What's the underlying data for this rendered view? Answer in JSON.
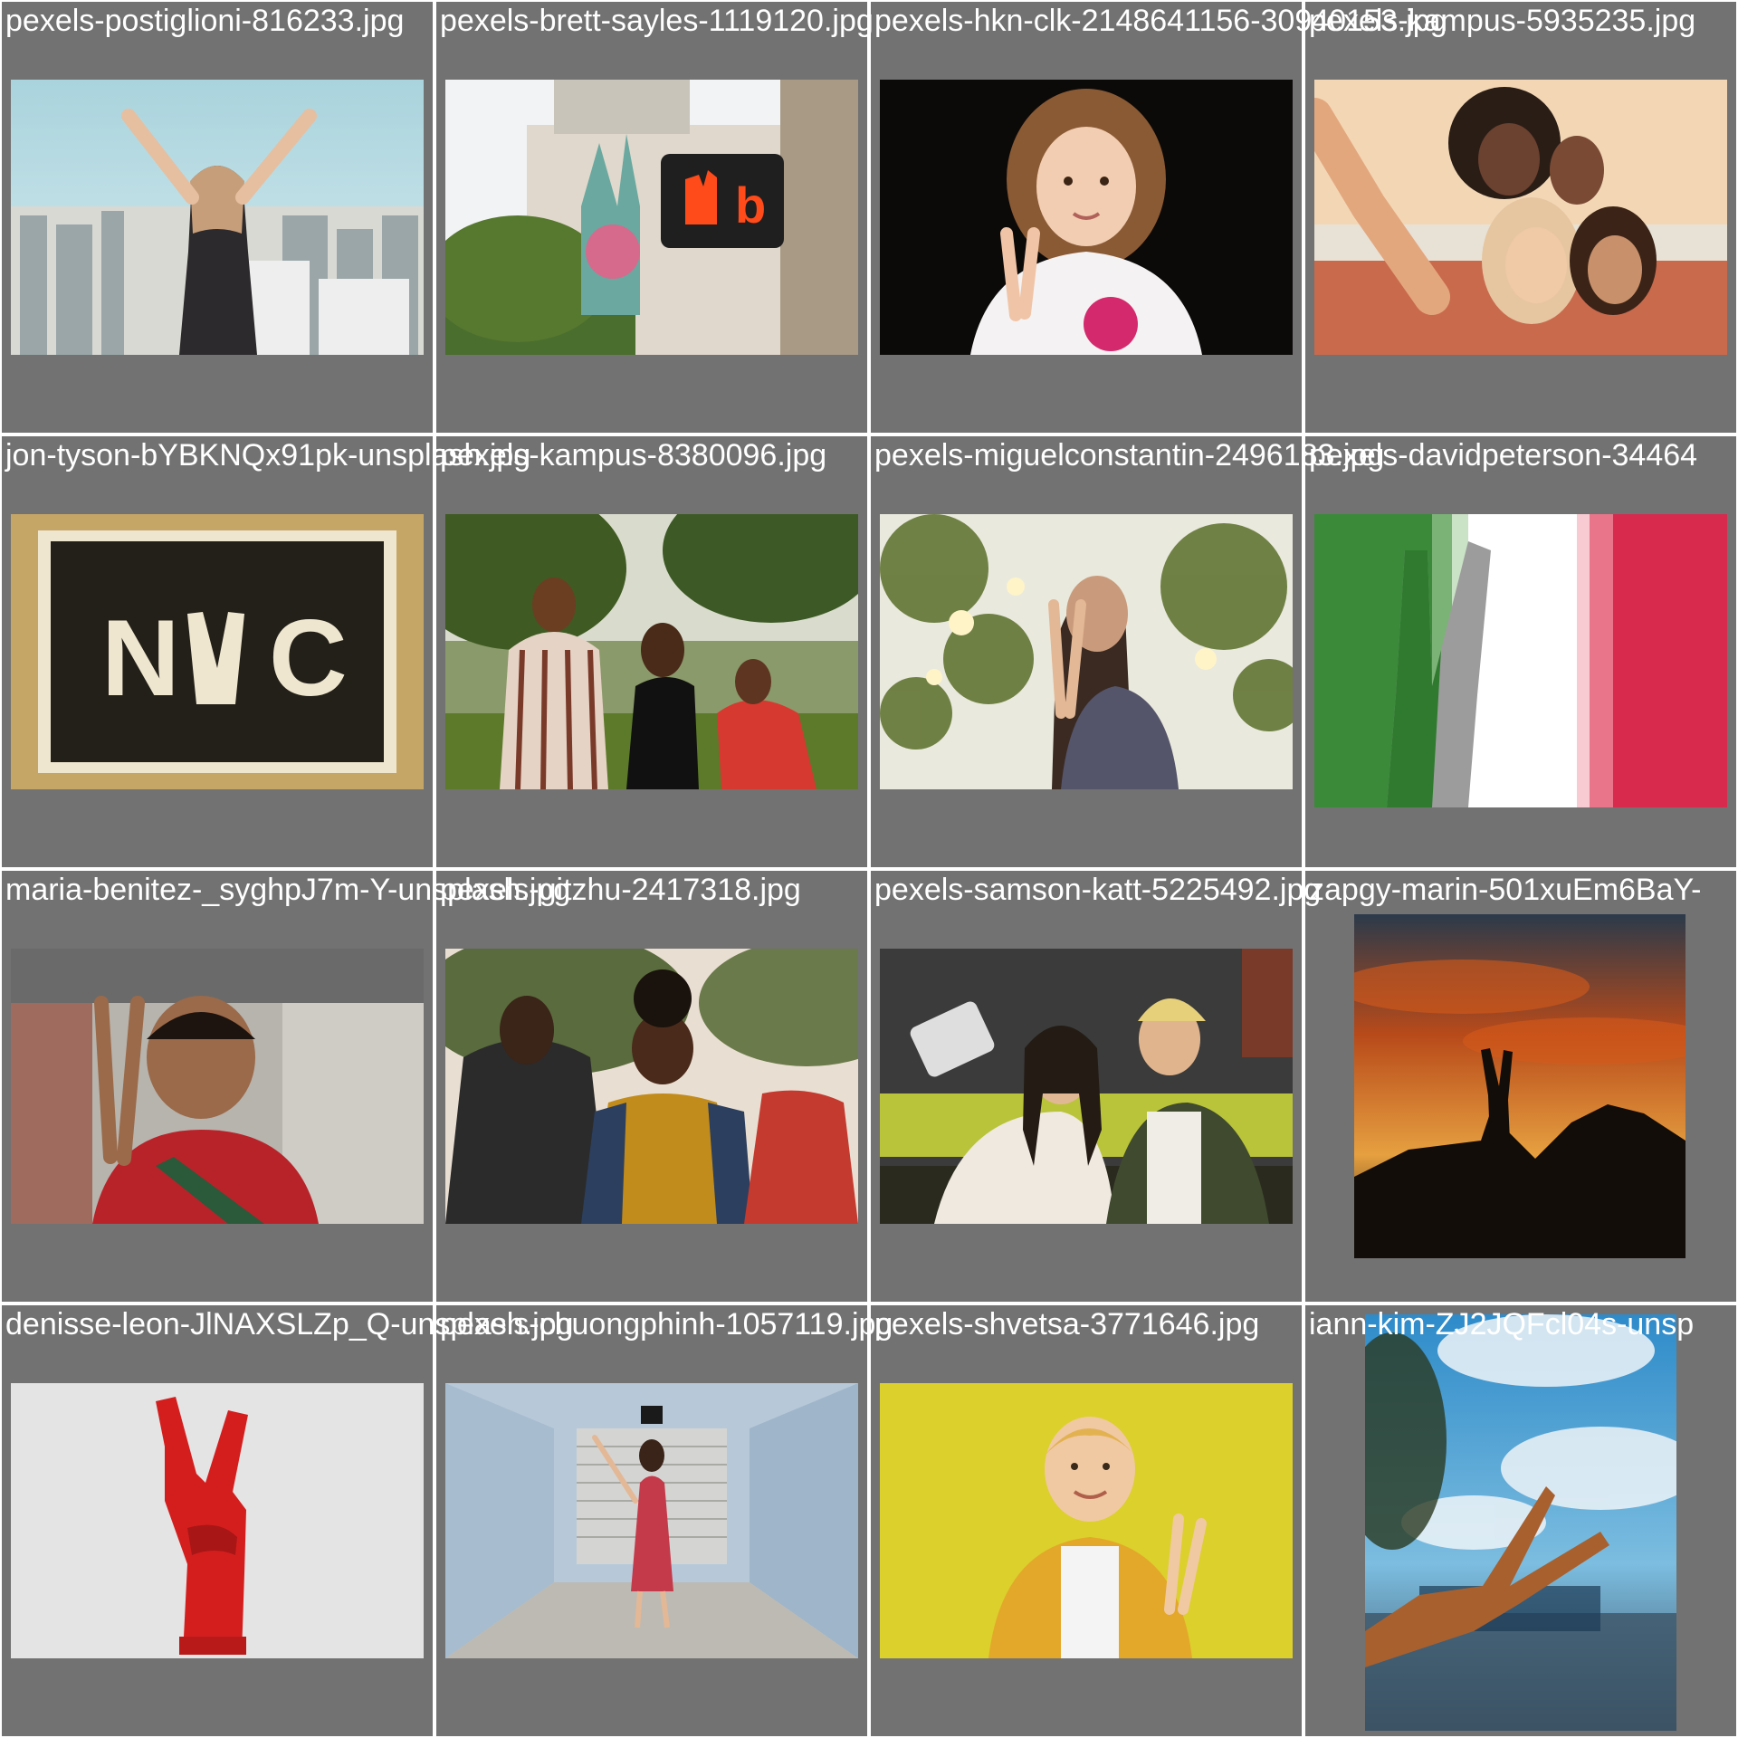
{
  "grid": {
    "background": "#727272",
    "separator": "#ffffff",
    "label_color": "#ffffff",
    "cells": [
      {
        "filename": "pexels-postiglioni-816233.jpg",
        "orientation": "landscape",
        "subject": "woman-peace-sign-city-icon"
      },
      {
        "filename": "pexels-brett-sayles-1119120.jpg",
        "orientation": "landscape",
        "subject": "crosswalk-signal-mural-icon"
      },
      {
        "filename": "pexels-hkn-clk-2148641156-30940153.jpg",
        "orientation": "landscape",
        "subject": "girl-peace-sign-icon"
      },
      {
        "filename": "pexels-kampus-5935235.jpg",
        "orientation": "landscape",
        "subject": "friends-selfie-icon"
      },
      {
        "filename": "jon-tyson-bYBKNQx91pk-unsplash.jpg",
        "orientation": "landscape",
        "subject": "nyc-banner-icon",
        "overlay_text": "N C"
      },
      {
        "filename": "pexels-kampus-8380096.jpg",
        "orientation": "landscape",
        "subject": "group-park-icon"
      },
      {
        "filename": "pexels-miguelconstantin-2496183.jpg",
        "orientation": "landscape",
        "subject": "woman-bokeh-peace-icon"
      },
      {
        "filename": "pexels-davidpeterson-34464",
        "orientation": "landscape",
        "subject": "italian-flag-hand-icon"
      },
      {
        "filename": "maria-benitez-_syghpJ7m-Y-unsplash.jpg",
        "orientation": "landscape",
        "subject": "man-peace-street-icon"
      },
      {
        "filename": "pexels-gitzhu-2417318.jpg",
        "orientation": "landscape",
        "subject": "couple-street-icon"
      },
      {
        "filename": "pexels-samson-katt-5225492.jpg",
        "orientation": "landscape",
        "subject": "couple-bench-selfie-icon"
      },
      {
        "filename": "zapgy-marin-501xuEm6BaY-",
        "orientation": "portrait",
        "subject": "sunset-silhouette-hand-icon"
      },
      {
        "filename": "denisse-leon-JlNAXSLZp_Q-unsplash.jpg",
        "orientation": "landscape",
        "subject": "red-hand-sculpture-icon"
      },
      {
        "filename": "pexels-chuongphinh-1057119.jpg",
        "orientation": "landscape",
        "subject": "woman-corridor-icon"
      },
      {
        "filename": "pexels-shvetsa-3771646.jpg",
        "orientation": "landscape",
        "subject": "boy-yellow-background-icon"
      },
      {
        "filename": "iann-kim-ZJ2JQFcl04s-unsp",
        "orientation": "portrait",
        "subject": "hand-sky-blur-icon"
      }
    ]
  }
}
